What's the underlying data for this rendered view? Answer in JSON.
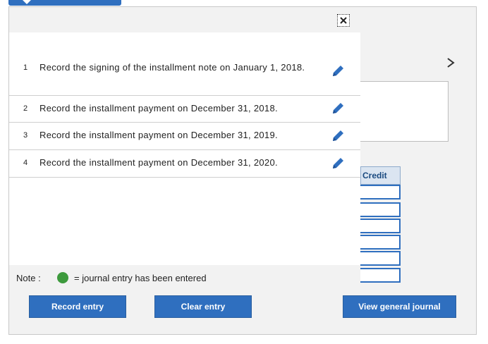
{
  "tasks": [
    {
      "num": "1",
      "label": "Record the signing of the installment note on January 1, 2018."
    },
    {
      "num": "2",
      "label": "Record the installment payment on December 31, 2018."
    },
    {
      "num": "3",
      "label": "Record the installment payment on December 31, 2019."
    },
    {
      "num": "4",
      "label": "Record the installment payment on December 31, 2020."
    }
  ],
  "note": {
    "label": "Note :",
    "text": "= journal entry has been entered",
    "dot_color": "#3d9a3d"
  },
  "buttons": {
    "record": "Record entry",
    "clear": "Clear entry",
    "view": "View general journal"
  },
  "journal": {
    "credit_header": "Credit"
  },
  "colors": {
    "accent": "#2f6fbf",
    "pencil": "#2f6fbf"
  },
  "icons": {
    "close": "close-icon",
    "edit": "pencil-icon",
    "next": "chevron-right-icon"
  }
}
